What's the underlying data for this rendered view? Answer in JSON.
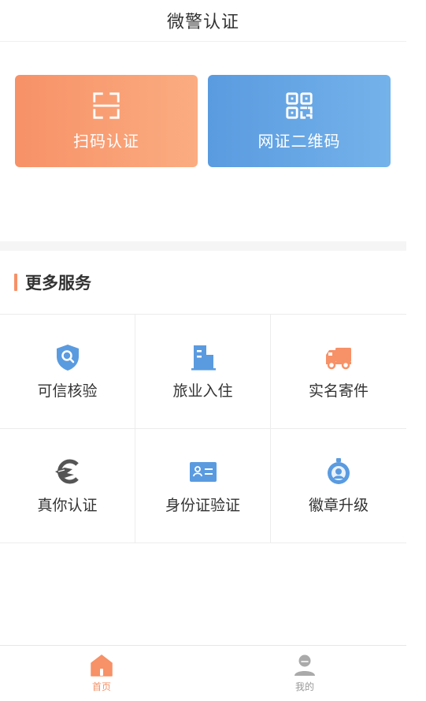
{
  "header": {
    "title": "微警认证"
  },
  "actions": [
    {
      "label": "扫码认证",
      "icon": "scan-frame-icon"
    },
    {
      "label": "网证二维码",
      "icon": "qr-code-icon"
    }
  ],
  "section": {
    "title": "更多服务"
  },
  "services": [
    {
      "label": "可信核验",
      "icon": "shield-search-icon"
    },
    {
      "label": "旅业入住",
      "icon": "building-icon"
    },
    {
      "label": "实名寄件",
      "icon": "delivery-truck-icon"
    },
    {
      "label": "真你认证",
      "icon": "fingerprint-hand-icon"
    },
    {
      "label": "身份证验证",
      "icon": "id-card-icon"
    },
    {
      "label": "徽章升级",
      "icon": "badge-medal-icon"
    }
  ],
  "tabbar": {
    "items": [
      {
        "label": "首页",
        "icon": "home-icon",
        "active": true
      },
      {
        "label": "我的",
        "icon": "profile-icon",
        "active": false
      }
    ]
  },
  "colors": {
    "accent_orange": "#f79167",
    "accent_blue": "#5a9be0",
    "text": "#333333",
    "inactive": "#999999"
  }
}
